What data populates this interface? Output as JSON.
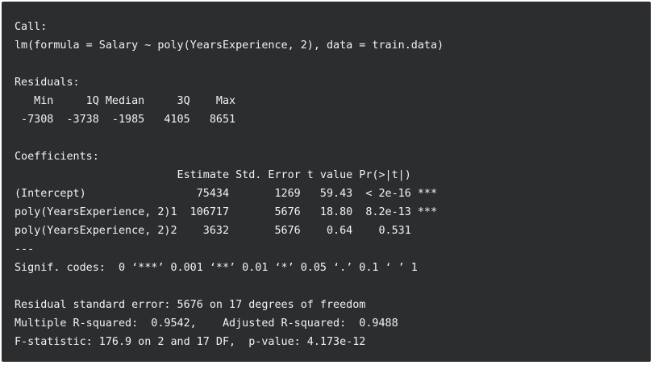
{
  "console": {
    "call_header": "Call:",
    "call_formula": "lm(formula = Salary ~ poly(YearsExperience, 2), data = train.data)",
    "residuals_header": "Residuals:",
    "residuals_columns": "   Min     1Q Median     3Q    Max ",
    "residuals_values": " -7308  -3738  -1985   4105   8651 ",
    "coefficients_header": "Coefficients:",
    "coef_columns": "                         Estimate Std. Error t value Pr(>|t|)    ",
    "coef_rows": [
      "(Intercept)                 75434       1269   59.43  < 2e-16 ***",
      "poly(YearsExperience, 2)1  106717       5676   18.80  8.2e-13 ***",
      "poly(YearsExperience, 2)2    3632       5676    0.64    0.531    "
    ],
    "separator": "---",
    "signif_codes": "Signif. codes:  0 ‘***’ 0.001 ‘**’ 0.01 ‘*’ 0.05 ‘.’ 0.1 ‘ ’ 1",
    "residual_se": "Residual standard error: 5676 on 17 degrees of freedom",
    "r_squared": "Multiple R-squared:  0.9542,\tAdjusted R-squared:  0.9488 ",
    "f_statistic": "F-statistic: 176.9 on 2 and 17 DF,  p-value: 4.173e-12"
  }
}
